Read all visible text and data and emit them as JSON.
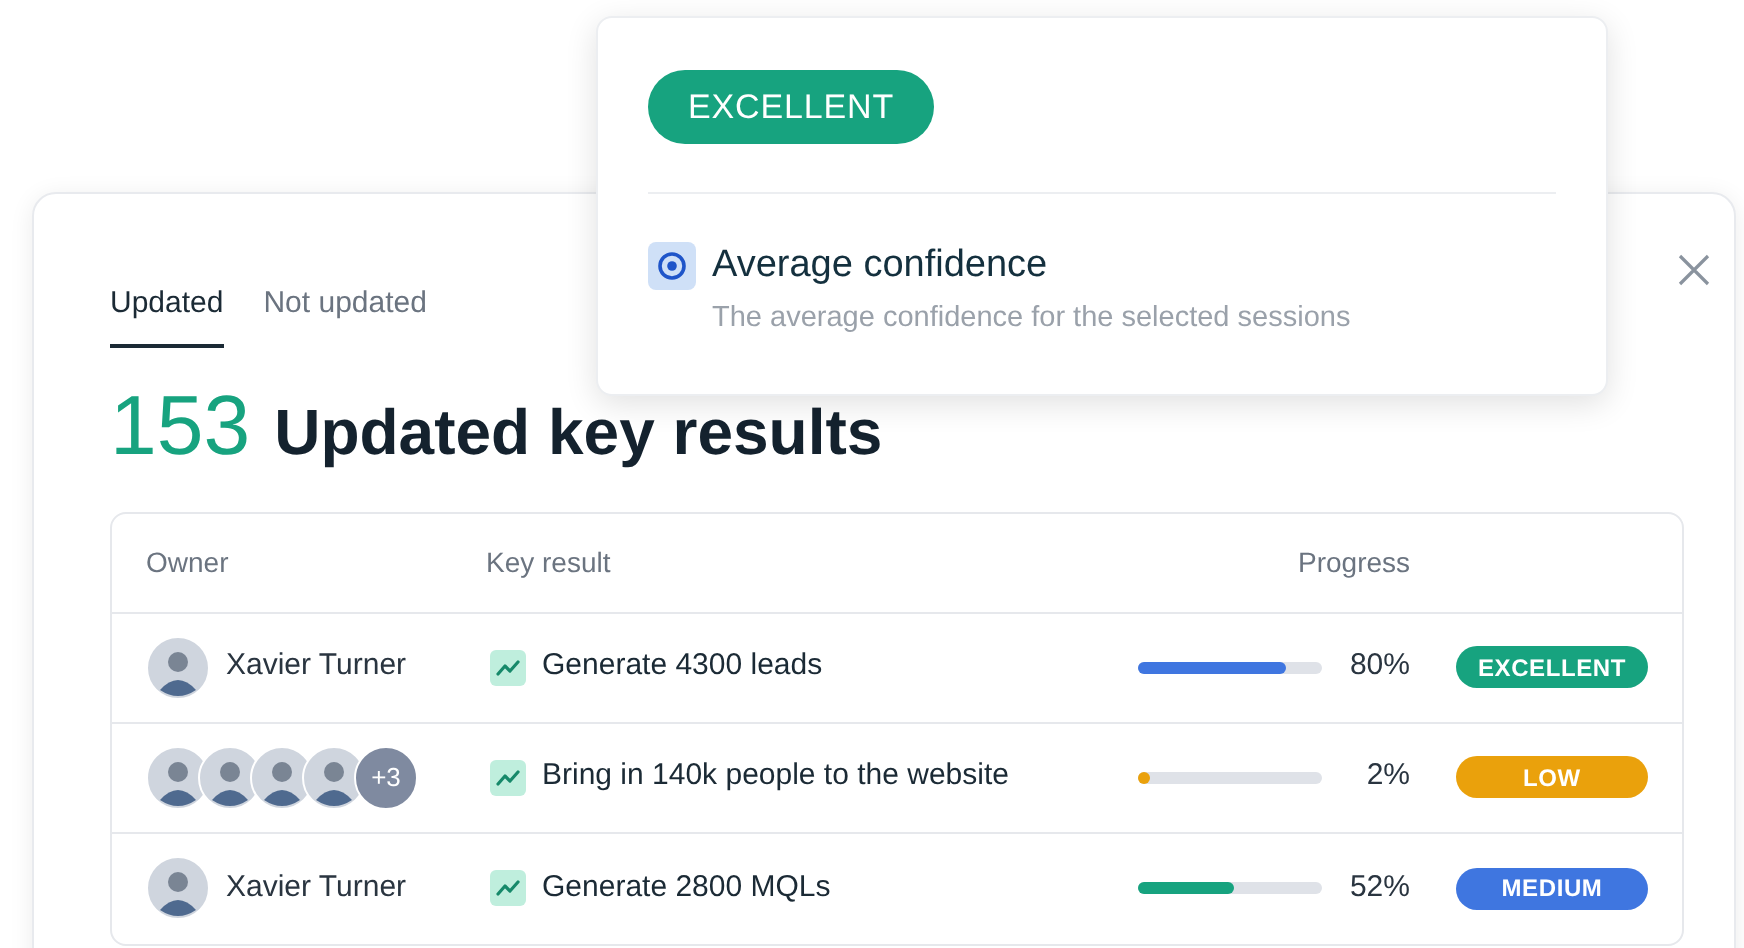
{
  "popover": {
    "badge": {
      "label": "EXCELLENT",
      "color": "#17a37f"
    },
    "option": {
      "title": "Average confidence",
      "description": "The average confidence for the selected sessions",
      "selected": true
    }
  },
  "tabs": [
    {
      "label": "Updated",
      "selected": true
    },
    {
      "label": "Not updated",
      "selected": false
    }
  ],
  "heading": {
    "count": "153",
    "title": "Updated key results"
  },
  "table": {
    "columns": [
      "Owner",
      "Key result",
      "Progress"
    ],
    "rows": [
      {
        "owners": [
          {
            "kind": "person",
            "name": "Xavier Turner"
          }
        ],
        "key_result": "Generate 4300 leads",
        "progress": {
          "level": 0.8,
          "color": "#3f76e0"
        },
        "percent": "80%",
        "badge": {
          "label": "EXCELLENT",
          "color": "#17a37f"
        }
      },
      {
        "owners": [
          {
            "kind": "avatar"
          },
          {
            "kind": "avatar"
          },
          {
            "kind": "avatar"
          },
          {
            "kind": "avatar"
          }
        ],
        "more": "+3",
        "key_result": "Bring in 140k people to the website",
        "progress": {
          "level": 0.02,
          "color": "#eaa10c"
        },
        "percent": "2%",
        "badge": {
          "label": "LOW",
          "color": "#eaa10c"
        }
      },
      {
        "owners": [
          {
            "kind": "person",
            "name": "Xavier Turner"
          }
        ],
        "key_result": "Generate 2800 MQLs",
        "progress": {
          "level": 0.52,
          "color": "#17a37f"
        },
        "percent": "52%",
        "badge": {
          "label": "MEDIUM",
          "color": "#3f76e0"
        }
      }
    ]
  }
}
